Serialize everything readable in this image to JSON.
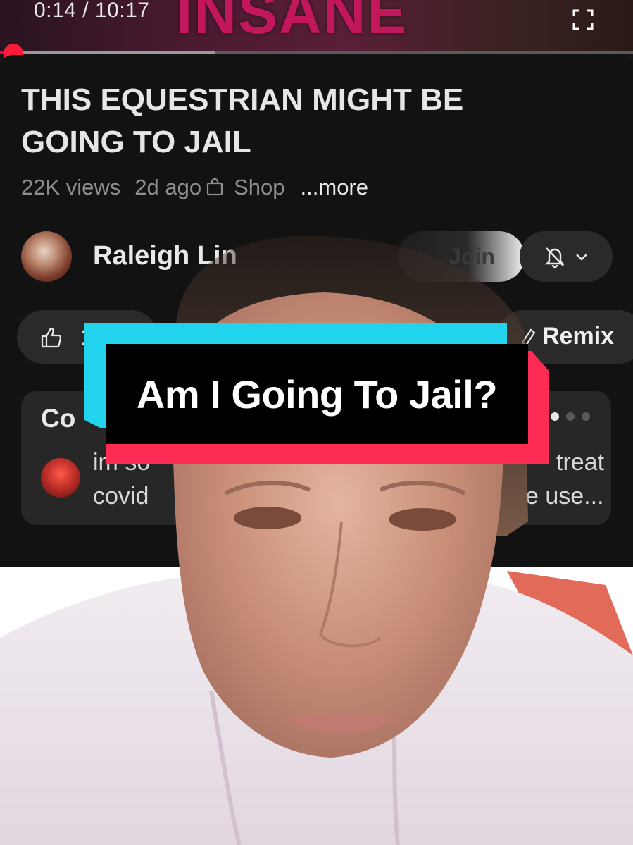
{
  "player": {
    "time": "0:14 / 10:17",
    "banner": "INSANE",
    "progress_fraction": 0.023,
    "buffered_fraction": 0.34
  },
  "video": {
    "title": "THIS EQUESTRIAN MIGHT BE GOING TO JAIL",
    "views": "22K views",
    "age": "2d ago",
    "shop_label": "Shop",
    "more_label": "...more"
  },
  "channel": {
    "name": "Raleigh Lin",
    "join_label": "Join"
  },
  "actions": {
    "like_count": "1",
    "remix_label": "Remix"
  },
  "comments": {
    "heading": "Co",
    "line1_start": "im so",
    "line1_end": "treat",
    "line2_start": "covid",
    "line2_end": "e use..."
  },
  "overlay": {
    "caption": "Am I Going To Jail?",
    "colors": {
      "cyan": "#22d3ee",
      "red": "#fe2c55",
      "black": "#000000"
    }
  },
  "icons": [
    "fullscreen-icon",
    "shop-icon",
    "bell-off-icon",
    "chevron-down-icon",
    "like-icon",
    "remix-icon"
  ]
}
